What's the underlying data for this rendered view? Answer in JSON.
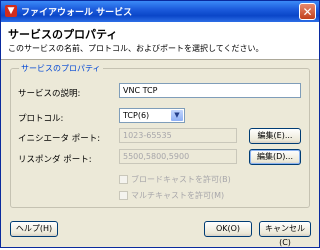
{
  "window": {
    "title": "ファイアウォール サービス",
    "close_glyph": "✕",
    "app_icon_glyph": "▼"
  },
  "header": {
    "title": "サービスのプロパティ",
    "description": "このサービスの名前、プロトコル、およびポートを選択してください。"
  },
  "group": {
    "legend": "サービスのプロパティ"
  },
  "form": {
    "service_desc_label": "サービスの説明:",
    "service_desc_value": "VNC TCP",
    "protocol_label": "プロトコル:",
    "protocol_value": "TCP(6)",
    "initiator_label": "イニシエータ ポート:",
    "initiator_value": "1023-65535",
    "responder_label": "リスポンダ ポート:",
    "responder_value": "5500,5800,5900",
    "edit_button_1": "編集(E)...",
    "edit_button_2": "編集(D)...",
    "broadcast_label": "ブロードキャストを許可(B)",
    "multicast_label": "マルチキャストを許可(M)"
  },
  "footer": {
    "help": "ヘルプ(H)",
    "ok": "OK(O)",
    "cancel": "キャンセル(C)"
  }
}
